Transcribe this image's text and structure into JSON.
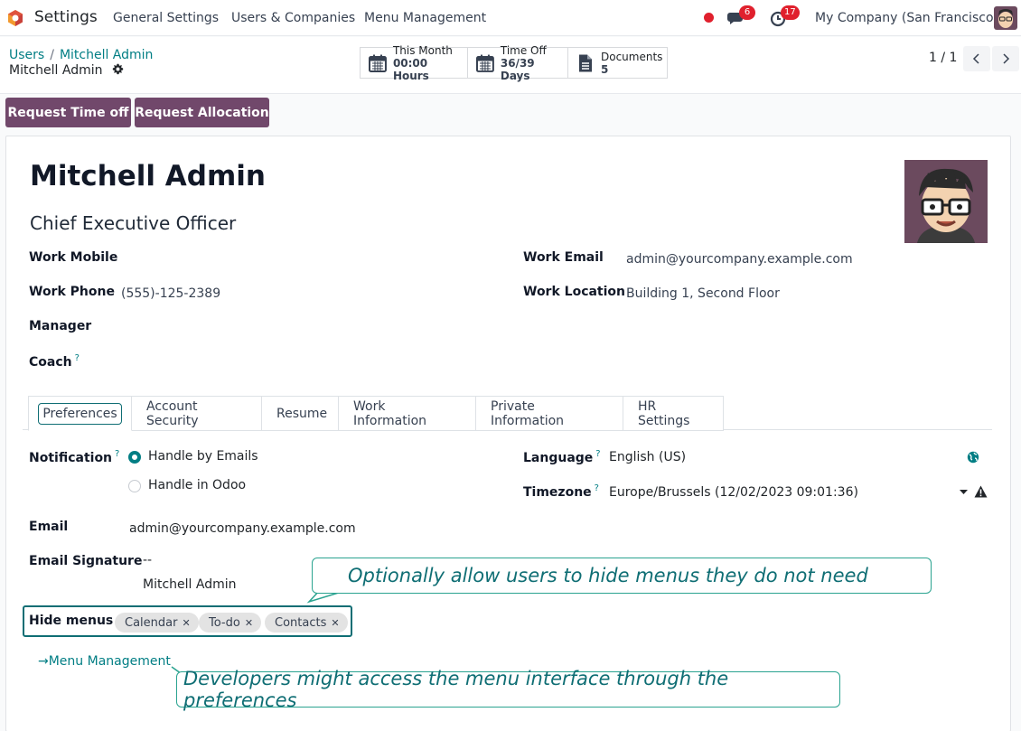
{
  "navbar": {
    "app_name": "Settings",
    "menu": [
      "General Settings",
      "Users & Companies",
      "Menu Management"
    ],
    "messages_count": "6",
    "activities_count": "17",
    "company": "My Company (San Francisco)"
  },
  "breadcrumb": {
    "root": "Users",
    "separator": "/",
    "current": "Mitchell Admin"
  },
  "record_name": "Mitchell Admin",
  "stat_buttons": [
    {
      "label": "This Month",
      "value": "00:00 Hours",
      "icon": "calendar-icon"
    },
    {
      "label": "Time Off",
      "value": "36/39 Days",
      "icon": "calendar-icon"
    },
    {
      "label": "Documents",
      "value": "5",
      "icon": "document-icon"
    }
  ],
  "pager": {
    "value": "1 / 1"
  },
  "actions": {
    "request_time_off": "Request Time off",
    "request_allocation": "Request Allocation"
  },
  "employee": {
    "name": "Mitchell Admin",
    "job_title": "Chief Executive Officer",
    "work_mobile_label": "Work Mobile",
    "work_mobile": "",
    "work_phone_label": "Work Phone",
    "work_phone": "(555)-125-2389",
    "manager_label": "Manager",
    "coach_label": "Coach",
    "help_mark": "?",
    "work_email_label": "Work Email",
    "work_email": "admin@yourcompany.example.com",
    "work_location_label": "Work Location",
    "work_location": "Building 1, Second Floor"
  },
  "tabs": [
    "Preferences",
    "Account Security",
    "Resume",
    "Work Information",
    "Private Information",
    "HR Settings"
  ],
  "preferences": {
    "notification_label": "Notification",
    "notification_options": [
      "Handle by Emails",
      "Handle in Odoo"
    ],
    "notification_selected": "Handle by Emails",
    "language_label": "Language",
    "language": "English (US)",
    "timezone_label": "Timezone",
    "timezone": "Europe/Brussels (12/02/2023 09:01:36)",
    "email_label": "Email",
    "email": "admin@yourcompany.example.com",
    "signature_label": "Email Signature",
    "signature_dashes": "--",
    "signature_name": "Mitchell Admin",
    "hide_menus_label": "Hide menus",
    "hide_menus": [
      "Calendar",
      "To-do",
      "Contacts"
    ],
    "menu_management_link": "→Menu Management"
  },
  "callouts": {
    "hide_menus": "Optionally allow users to hide menus they do not need",
    "menu_link": "Developers might access the menu interface through the preferences"
  },
  "colors": {
    "accent": "#017e84",
    "primary_button": "#71486b",
    "badge": "#e0202d",
    "callout_border": "#2aa390"
  }
}
